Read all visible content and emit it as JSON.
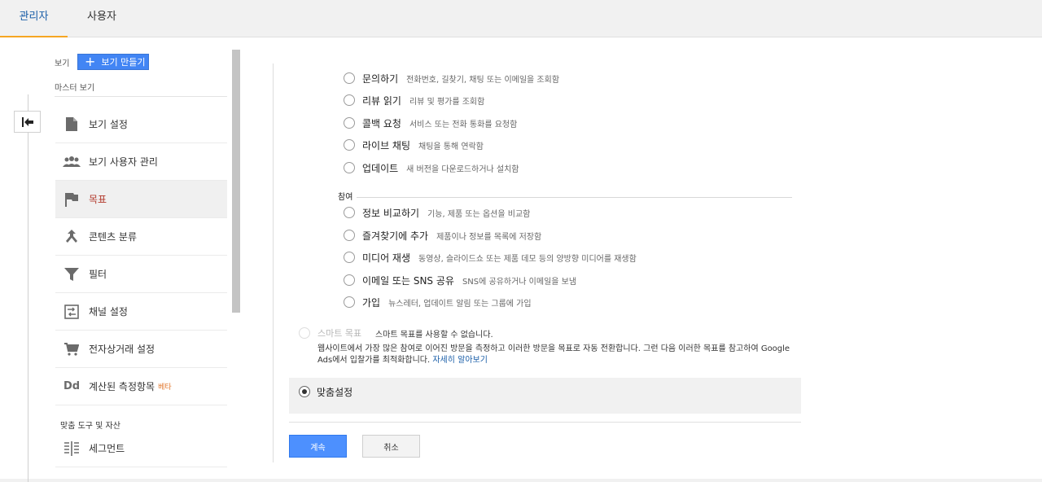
{
  "tabs": {
    "admin": "관리자",
    "user": "사용자"
  },
  "sidebar": {
    "view_label": "보기",
    "new_view_button": "보기 만들기",
    "master_view": "마스터 보기",
    "items": [
      {
        "label": "보기 설정",
        "icon": "document-icon"
      },
      {
        "label": "보기 사용자 관리",
        "icon": "people-icon"
      },
      {
        "label": "목표",
        "icon": "flag-icon",
        "active": true
      },
      {
        "label": "콘텐츠 분류",
        "icon": "merge-icon"
      },
      {
        "label": "필터",
        "icon": "filter-icon"
      },
      {
        "label": "채널 설정",
        "icon": "channel-settings-icon"
      },
      {
        "label": "전자상거래 설정",
        "icon": "cart-icon"
      },
      {
        "label": "계산된 측정항목",
        "icon": "dd-icon",
        "badge": "베타"
      }
    ],
    "tools_label": "맞춤 도구 및 자산",
    "segment_label": "세그먼트"
  },
  "goals": {
    "top_options": [
      {
        "name": "문의하기",
        "desc": "전화번호, 길찾기, 채팅 또는 이메일을 조회함"
      },
      {
        "name": "리뷰 읽기",
        "desc": "리뷰 및 평가를 조회함"
      },
      {
        "name": "콜백 요청",
        "desc": "서비스 또는 전화 통화를 요청함"
      },
      {
        "name": "라이브 채팅",
        "desc": "채팅을 통해 연락함"
      },
      {
        "name": "업데이트",
        "desc": "새 버전을 다운로드하거나 설치함"
      }
    ],
    "engagement_heading": "참여",
    "engagement_options": [
      {
        "name": "정보 비교하기",
        "desc": "기능, 제품 또는 옵션을 비교함"
      },
      {
        "name": "즐겨찾기에 추가",
        "desc": "제품이나 정보를 목록에 저장함"
      },
      {
        "name": "미디어 재생",
        "desc": "동영상, 슬라이드쇼 또는 제품 데모 등의 양방향 미디어를 재생함"
      },
      {
        "name": "이메일 또는 SNS 공유",
        "desc": "SNS에 공유하거나 이메일을 보냄"
      },
      {
        "name": "가입",
        "desc": "뉴스레터, 업데이트 알림 또는 그룹에 가입"
      }
    ],
    "smart": {
      "name": "스마트 목표",
      "note": "스마트 목표를 사용할 수 없습니다.",
      "desc": "웹사이트에서 가장 많은 참여로 이어진 방문을 측정하고 이러한 방문을 목표로 자동 전환합니다. 그런 다음 이러한 목표를 참고하여 Google Ads에서 입찰가를 최적화합니다.",
      "learn_more": "자세히 알아보기"
    },
    "custom": "맞춤설정"
  },
  "actions": {
    "continue": "계속",
    "cancel": "취소"
  },
  "colors": {
    "accent": "#4285f4",
    "tab_underline": "#f5a623",
    "active_item": "#b23a2c",
    "beta": "#e2782e"
  }
}
